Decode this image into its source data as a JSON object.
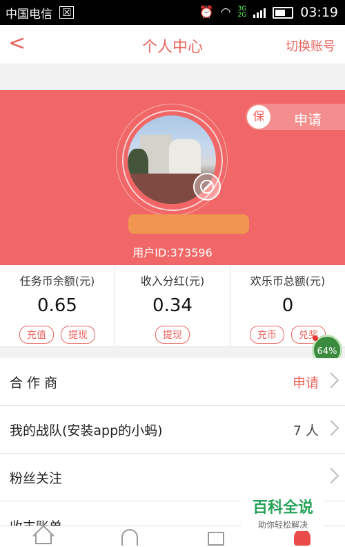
{
  "status_bar": {
    "carrier": "中国电信",
    "sim_icon_glyph": "☒",
    "network": [
      "3G",
      "2G"
    ],
    "time": "03:19"
  },
  "header": {
    "back_icon": "chevron-left-icon",
    "title": "个人中心",
    "switch_account": "切换账号"
  },
  "profile": {
    "apply_badge": "保",
    "apply_label": "申请",
    "user_id": "用户ID:373596"
  },
  "stats": [
    {
      "label": "任务币余额(元)",
      "value": "0.65",
      "buttons": [
        "充值",
        "提现"
      ]
    },
    {
      "label": "收入分红(元)",
      "value": "0.34",
      "buttons": [
        "提现"
      ]
    },
    {
      "label": "欢乐币总额(元)",
      "value": "0",
      "buttons": [
        "充币",
        "兑奖"
      ]
    }
  ],
  "overlay_progress": "64%",
  "menu": [
    {
      "name": "合 作 商",
      "value": "申请",
      "value_color": "#e8655f"
    },
    {
      "name": "我的战队(安装app的小蚂)",
      "value": "7 人",
      "value_color": "#444444"
    },
    {
      "name": "粉丝关注",
      "value": "",
      "value_color": "#444444"
    },
    {
      "name": "收支账单",
      "value": "",
      "value_color": "#444444"
    }
  ],
  "tabbar": [
    "home-icon",
    "bell-icon",
    "ranking-icon",
    "user-icon"
  ],
  "watermark": {
    "title": "百科全说",
    "subtitle": "助你轻松解决"
  },
  "colors": {
    "accent": "#e8655f",
    "hero_bg": "#f16767"
  }
}
